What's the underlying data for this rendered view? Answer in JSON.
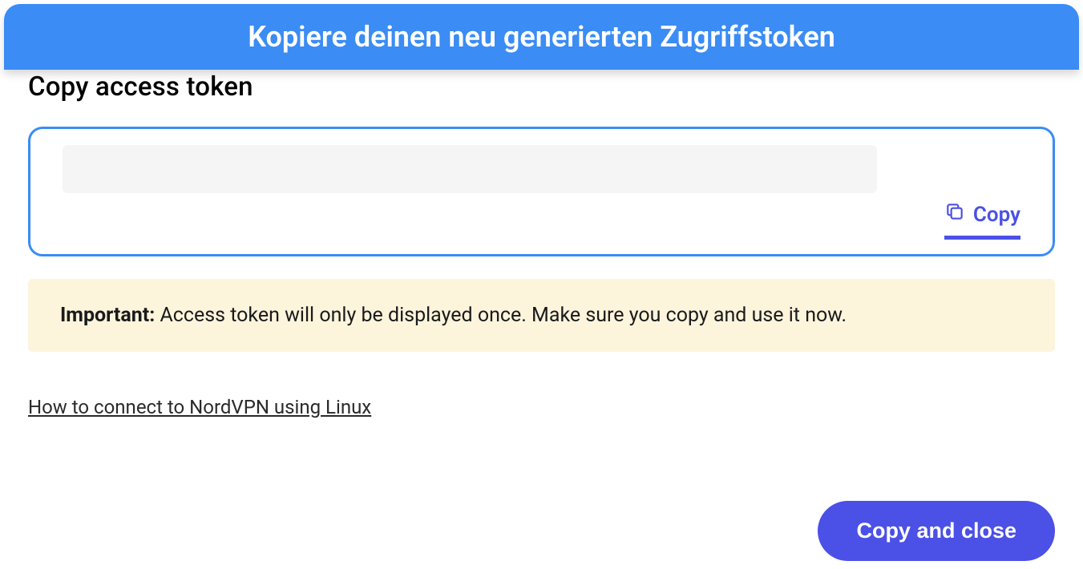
{
  "banner": {
    "text": "Kopiere deinen neu generierten Zugriffstoken"
  },
  "dialog": {
    "title": "Copy access token",
    "token_value": "",
    "copy_label": "Copy"
  },
  "alert": {
    "strong": "Important:",
    "message": " Access token will only be displayed once. Make sure you copy and use it now."
  },
  "help_link": {
    "label": "How to connect to NordVPN using Linux"
  },
  "actions": {
    "copy_and_close": "Copy and close"
  }
}
